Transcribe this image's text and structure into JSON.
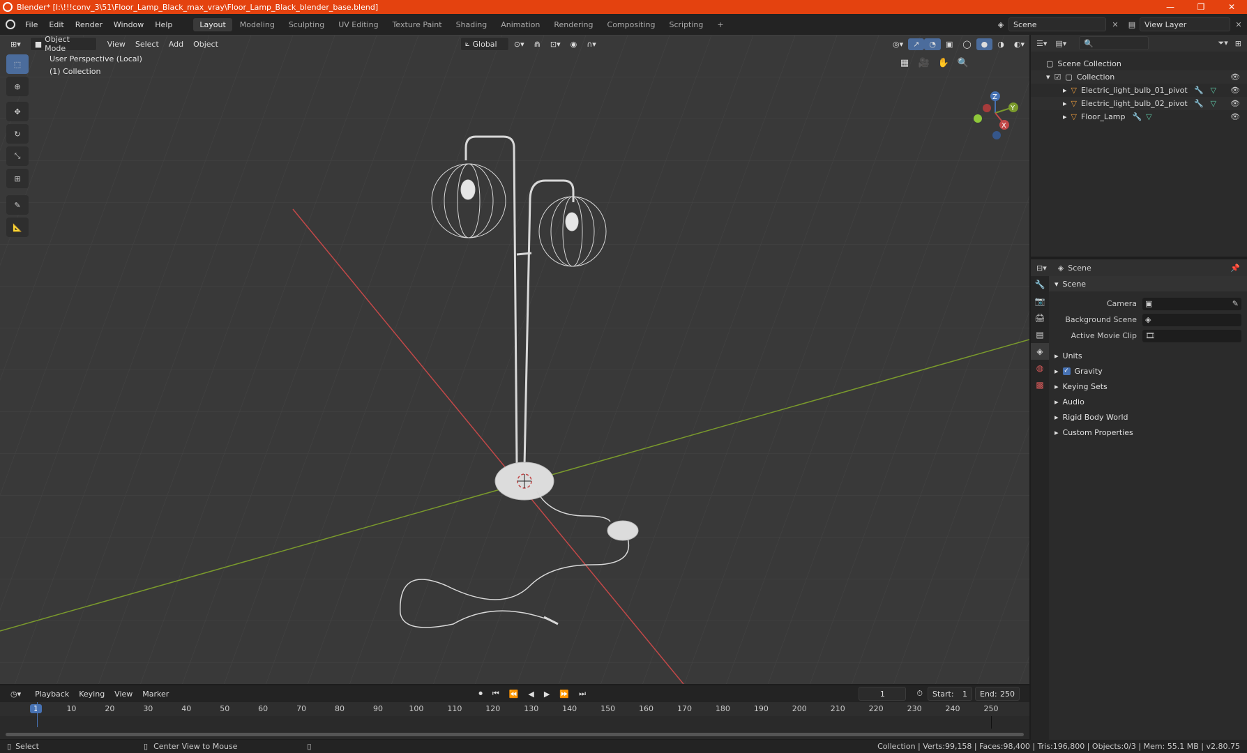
{
  "window": {
    "title": "Blender* [I:\\!!!conv_3\\51\\Floor_Lamp_Black_max_vray\\Floor_Lamp_Black_blender_base.blend]",
    "minimize": "—",
    "maximize": "❐",
    "close": "✕"
  },
  "menu": {
    "items": [
      "File",
      "Edit",
      "Render",
      "Window",
      "Help"
    ]
  },
  "workspaces": {
    "tabs": [
      "Layout",
      "Modeling",
      "Sculpting",
      "UV Editing",
      "Texture Paint",
      "Shading",
      "Animation",
      "Rendering",
      "Compositing",
      "Scripting"
    ],
    "add": "+"
  },
  "scene_selector": {
    "value": "Scene"
  },
  "view_layer": {
    "value": "View Layer"
  },
  "viewport": {
    "mode": "Object Mode",
    "menus": [
      "View",
      "Select",
      "Add",
      "Object"
    ],
    "transform_orientation": "Global",
    "overlay_line1": "User Perspective (Local)",
    "overlay_line2": "(1) Collection",
    "gizmo": {
      "x": "X",
      "y": "Y",
      "z": "Z"
    }
  },
  "outliner": {
    "root": "Scene Collection",
    "collection": "Collection",
    "items": [
      "Electric_light_bulb_01_pivot",
      "Electric_light_bulb_02_pivot",
      "Floor_Lamp"
    ]
  },
  "properties": {
    "header": "Scene",
    "section": "Scene",
    "fields": [
      {
        "label": "Camera",
        "value": ""
      },
      {
        "label": "Background Scene",
        "value": ""
      },
      {
        "label": "Active Movie Clip",
        "value": ""
      }
    ],
    "panels": [
      "Units",
      "Gravity",
      "Keying Sets",
      "Audio",
      "Rigid Body World",
      "Custom Properties"
    ]
  },
  "timeline": {
    "menus": [
      "Playback",
      "Keying",
      "View",
      "Marker"
    ],
    "current_frame": "1",
    "start_label": "Start:",
    "start": "1",
    "end_label": "End:",
    "end": "250",
    "ticks": [
      "1",
      "10",
      "20",
      "30",
      "40",
      "50",
      "60",
      "70",
      "80",
      "90",
      "100",
      "110",
      "120",
      "130",
      "140",
      "150",
      "160",
      "170",
      "180",
      "190",
      "200",
      "210",
      "220",
      "230",
      "240",
      "250"
    ]
  },
  "status": {
    "left1": "Select",
    "left2": "Center View to Mouse",
    "right": "Collection | Verts:99,158 | Faces:98,400 | Tris:196,800 | Objects:0/3 | Mem: 55.1 MB | v2.80.75"
  },
  "colors": {
    "titlebar": "#e4420f",
    "x_axis": "#c24848",
    "y_axis": "#7a9a2c",
    "active_tool": "#4b6c9c",
    "frame_marker": "#4772b3"
  }
}
